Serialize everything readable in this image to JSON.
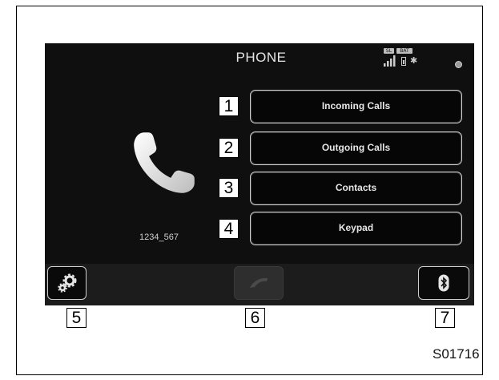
{
  "screen": {
    "title": "PHONE",
    "status": {
      "tag_left": "SL",
      "tag_right": "BAT",
      "bluetooth_glyph": "✱"
    },
    "phone_number": "1234_567",
    "menu": [
      {
        "label": "Incoming Calls"
      },
      {
        "label": "Outgoing Calls"
      },
      {
        "label": "Contacts"
      },
      {
        "label": "Keypad"
      }
    ],
    "bottom_buttons": [
      {
        "icon": "settings-icon"
      },
      {
        "icon": "handset-icon"
      },
      {
        "icon": "bluetooth-icon"
      }
    ]
  },
  "callouts": [
    "1",
    "2",
    "3",
    "4",
    "5",
    "6",
    "7"
  ],
  "figure_code": "S01716"
}
